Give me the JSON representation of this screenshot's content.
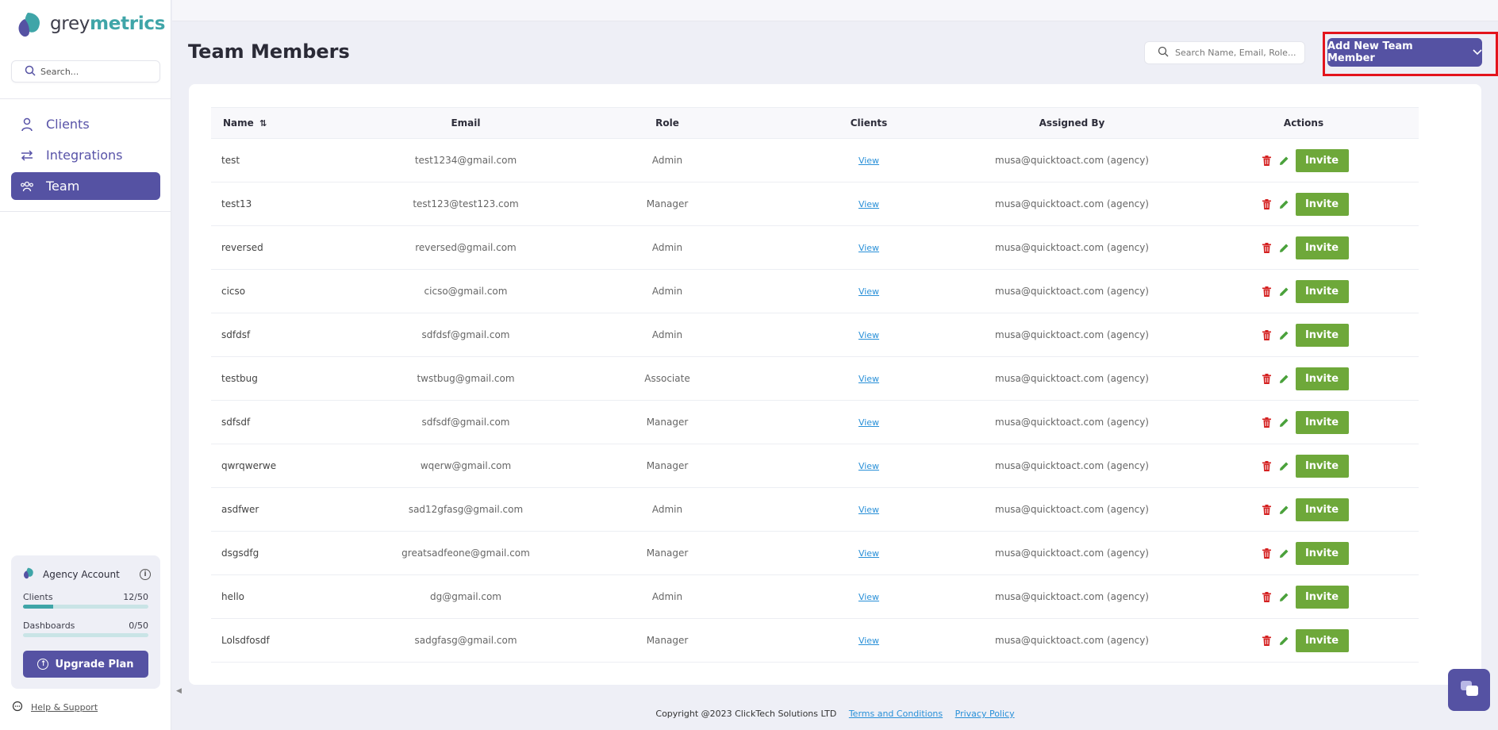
{
  "brand": {
    "name_part1": "grey",
    "name_part2": "metrics",
    "accent": "#3fa5a8",
    "primary": "#5552a3"
  },
  "sidebar": {
    "search_placeholder": "Search...",
    "nav": [
      {
        "label": "Clients",
        "icon": "user-icon",
        "active": false
      },
      {
        "label": "Integrations",
        "icon": "arrows-exchange-icon",
        "active": false
      },
      {
        "label": "Team",
        "icon": "team-icon",
        "active": true
      }
    ],
    "plan": {
      "title": "Agency Account",
      "clients_label": "Clients",
      "clients_value": "12/50",
      "clients_fraction": 0.24,
      "dashboards_label": "Dashboards",
      "dashboards_value": "0/50",
      "dashboards_fraction": 0,
      "upgrade_label": "Upgrade Plan"
    },
    "help_label": "Help & Support"
  },
  "header": {
    "title": "Team Members",
    "search_placeholder": "Search Name, Email, Role...",
    "add_button_label": "Add New Team Member"
  },
  "table": {
    "columns": {
      "name": "Name",
      "email": "Email",
      "role": "Role",
      "clients": "Clients",
      "assigned_by": "Assigned By",
      "actions": "Actions"
    },
    "view_label": "View",
    "invite_label": "Invite",
    "rows": [
      {
        "name": "test",
        "email": "test1234@gmail.com",
        "role": "Admin",
        "assigned_by": "musa@quicktoact.com (agency)"
      },
      {
        "name": "test13",
        "email": "test123@test123.com",
        "role": "Manager",
        "assigned_by": "musa@quicktoact.com (agency)"
      },
      {
        "name": "reversed",
        "email": "reversed@gmail.com",
        "role": "Admin",
        "assigned_by": "musa@quicktoact.com (agency)"
      },
      {
        "name": "cicso",
        "email": "cicso@gmail.com",
        "role": "Admin",
        "assigned_by": "musa@quicktoact.com (agency)"
      },
      {
        "name": "sdfdsf",
        "email": "sdfdsf@gmail.com",
        "role": "Admin",
        "assigned_by": "musa@quicktoact.com (agency)"
      },
      {
        "name": "testbug",
        "email": "twstbug@gmail.com",
        "role": "Associate",
        "assigned_by": "musa@quicktoact.com (agency)"
      },
      {
        "name": "sdfsdf",
        "email": "sdfsdf@gmail.com",
        "role": "Manager",
        "assigned_by": "musa@quicktoact.com (agency)"
      },
      {
        "name": "qwrqwerwe",
        "email": "wqerw@gmail.com",
        "role": "Manager",
        "assigned_by": "musa@quicktoact.com (agency)"
      },
      {
        "name": "asdfwer",
        "email": "sad12gfasg@gmail.com",
        "role": "Admin",
        "assigned_by": "musa@quicktoact.com (agency)"
      },
      {
        "name": "dsgsdfg",
        "email": "greatsadfeone@gmail.com",
        "role": "Manager",
        "assigned_by": "musa@quicktoact.com (agency)"
      },
      {
        "name": "hello",
        "email": "dg@gmail.com",
        "role": "Admin",
        "assigned_by": "musa@quicktoact.com (agency)"
      },
      {
        "name": "Lolsdfosdf",
        "email": "sadgfasg@gmail.com",
        "role": "Manager",
        "assigned_by": "musa@quicktoact.com (agency)"
      }
    ]
  },
  "footer": {
    "copyright": "Copyright @2023 ClickTech Solutions LTD",
    "terms": "Terms and Conditions",
    "privacy": "Privacy Policy"
  }
}
